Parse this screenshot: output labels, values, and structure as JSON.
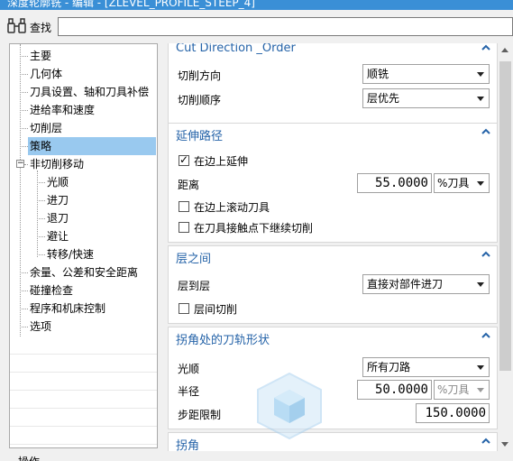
{
  "window": {
    "title": "深度轮廓铣 - 编辑 - [ZLEVEL_PROFILE_STEEP_4]"
  },
  "search": {
    "label": "查找",
    "value": ""
  },
  "tree": {
    "items": [
      {
        "label": "主要",
        "level": 0
      },
      {
        "label": "几何体",
        "level": 0
      },
      {
        "label": "刀具设置、轴和刀具补偿",
        "level": 0
      },
      {
        "label": "进给率和速度",
        "level": 0
      },
      {
        "label": "切削层",
        "level": 0
      },
      {
        "label": "策略",
        "level": 0,
        "selected": true
      },
      {
        "label": "非切削移动",
        "level": 0,
        "expander": "minus"
      },
      {
        "label": "光顺",
        "level": 1
      },
      {
        "label": "进刀",
        "level": 1
      },
      {
        "label": "退刀",
        "level": 1
      },
      {
        "label": "避让",
        "level": 1
      },
      {
        "label": "转移/快速",
        "level": 1
      },
      {
        "label": "余量、公差和安全距离",
        "level": 0
      },
      {
        "label": "碰撞检查",
        "level": 0
      },
      {
        "label": "程序和机床控制",
        "level": 0
      },
      {
        "label": "选项",
        "level": 0
      }
    ]
  },
  "cut_direction": {
    "title": "Cut Direction _Order",
    "direction_label": "切削方向",
    "direction_value": "顺铣",
    "order_label": "切削顺序",
    "order_value": "层优先"
  },
  "extend_path": {
    "title": "延伸路径",
    "extend_on_edge_label": "在边上延伸",
    "extend_on_edge_checked": true,
    "distance_label": "距离",
    "distance_value": "55.0000",
    "distance_unit": "%刀具",
    "roll_tool_label": "在边上滚动刀具",
    "roll_tool_checked": false,
    "continue_cut_label": "在刀具接触点下继续切削",
    "continue_cut_checked": false
  },
  "between_levels": {
    "title": "层之间",
    "level_to_level_label": "层到层",
    "level_to_level_value": "直接对部件进刀",
    "interlevel_cut_label": "层间切削",
    "interlevel_cut_checked": false
  },
  "corner": {
    "title": "拐角处的刀轨形状",
    "smooth_label": "光顺",
    "smooth_value": "所有刀路",
    "radius_label": "半径",
    "radius_value": "50.0000",
    "radius_unit": "%刀具",
    "step_limit_label": "步距限制",
    "step_limit_value": "150.0000"
  },
  "corner2": {
    "title": "拐角"
  },
  "bottom": {
    "label": "操作"
  },
  "colors": {
    "accent": "#2563a8",
    "selection": "#99c9ef",
    "titlebar": "#3a8fd6"
  }
}
